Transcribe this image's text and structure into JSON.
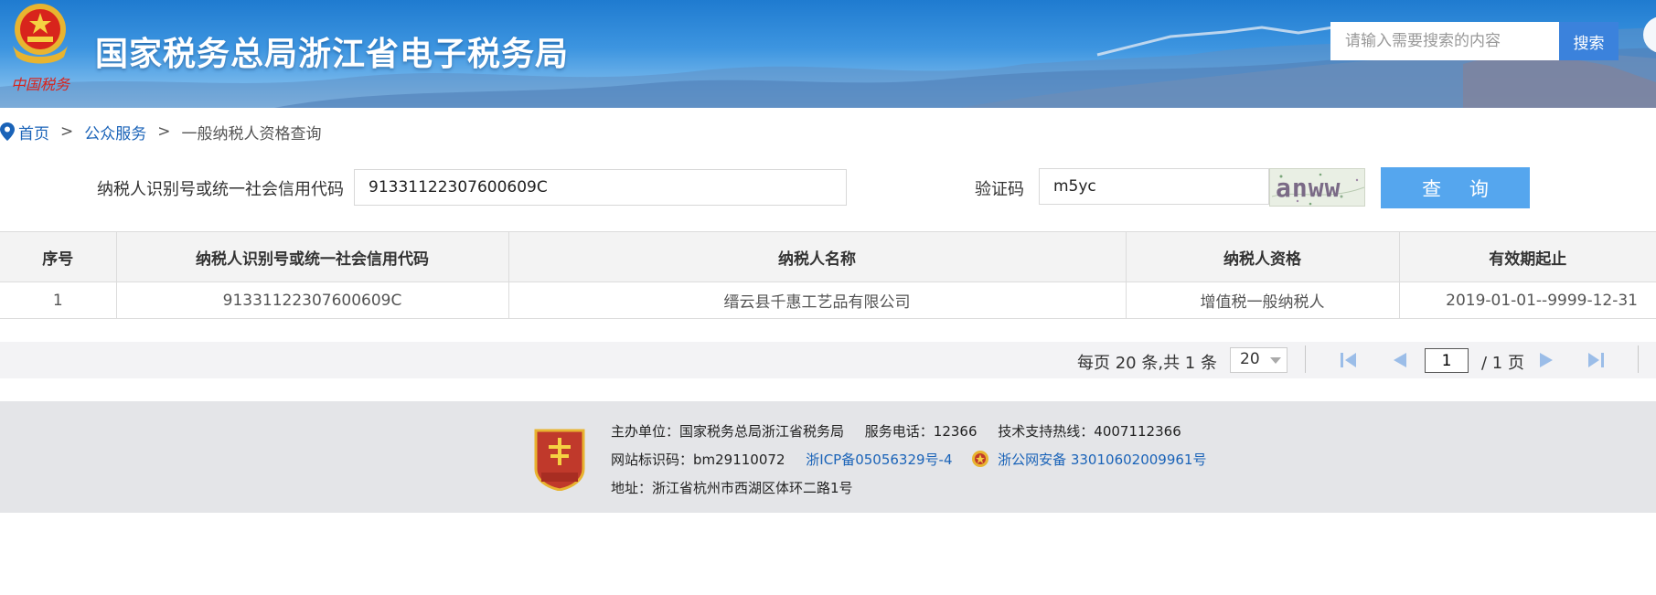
{
  "header": {
    "site_title": "国家税务总局浙江省电子税务局",
    "search_placeholder": "请输入需要搜索的内容",
    "search_button": "搜索"
  },
  "breadcrumb": {
    "home": "首页",
    "separator": ">",
    "section": "公众服务",
    "current": "一般纳税人资格查询"
  },
  "query_form": {
    "taxpayer_id_label": "纳税人识别号或统一社会信用代码",
    "taxpayer_id_value": "91331122307600609C",
    "captcha_label": "验证码",
    "captcha_value": "m5yc",
    "captcha_image_text": "anww",
    "query_button": "查 询"
  },
  "table": {
    "headers": [
      "序号",
      "纳税人识别号或统一社会信用代码",
      "纳税人名称",
      "纳税人资格",
      "有效期起止"
    ],
    "rows": [
      [
        "1",
        "91331122307600609C",
        "缙云县千惠工艺品有限公司",
        "增值税一般纳税人",
        "2019-01-01--9999-12-31"
      ]
    ]
  },
  "pagination": {
    "summary": "每页 20 条,共 1 条",
    "page_size": "20",
    "current_page": "1",
    "total_pages": "/ 1 页"
  },
  "footer": {
    "sponsor": "主办单位：国家税务总局浙江省税务局",
    "service_phone": "服务电话：12366",
    "support_hotline": "技术支持热线：4007112366",
    "site_id": "网站标识码：bm29110072",
    "icp": "浙ICP备05056329号-4",
    "police_record": "浙公网安备 33010602009961号",
    "address": "地址：浙江省杭州市西湖区体环二路1号"
  },
  "colors": {
    "header_blue": "#2f86d6",
    "search_button": "#3b82dc",
    "query_button": "#55a6ee",
    "link_blue": "#1a63b8",
    "emblem_red": "#d8241c",
    "emblem_gold": "#e8b430"
  }
}
